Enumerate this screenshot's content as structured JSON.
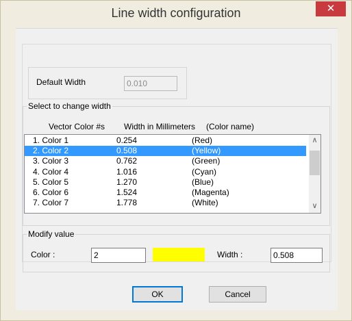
{
  "window": {
    "title": "Line width configuration",
    "close_glyph": "✕"
  },
  "default_width": {
    "label": "Default Width",
    "value": "0.010"
  },
  "select_group": {
    "label": "Select to change width"
  },
  "list": {
    "headers": {
      "color": "Vector Color #s",
      "width": "Width in Millimeters",
      "name": "(Color name)"
    },
    "rows": [
      {
        "color": "1. Color  1",
        "width": "0.254",
        "name": "(Red)"
      },
      {
        "color": "2. Color  2",
        "width": "0.508",
        "name": "(Yellow)"
      },
      {
        "color": "3. Color  3",
        "width": "0.762",
        "name": "(Green)"
      },
      {
        "color": "4. Color  4",
        "width": "1.016",
        "name": "(Cyan)"
      },
      {
        "color": "5. Color  5",
        "width": "1.270",
        "name": "(Blue)"
      },
      {
        "color": "6. Color  6",
        "width": "1.524",
        "name": "(Magenta)"
      },
      {
        "color": "7. Color  7",
        "width": "1.778",
        "name": "(White)"
      }
    ],
    "selected_index": 1,
    "scroll_up_glyph": "∧",
    "scroll_down_glyph": "∨"
  },
  "modify_group": {
    "label": "Modify value",
    "color_label": "Color :",
    "color_value": "2",
    "swatch_color": "#ffff00",
    "width_label": "Width :",
    "width_value": "0.508"
  },
  "buttons": {
    "ok": "OK",
    "cancel": "Cancel"
  }
}
